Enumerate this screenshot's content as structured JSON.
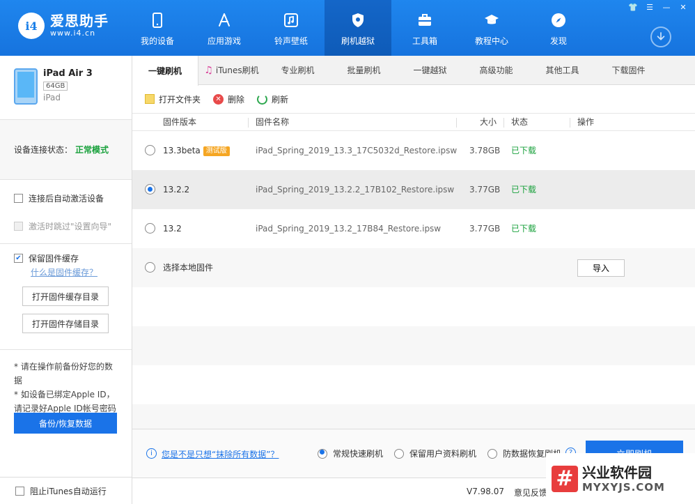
{
  "app": {
    "logo_badge": "i4",
    "logo_name": "爱思助手",
    "logo_url": "www.i4.cn"
  },
  "nav": [
    {
      "label": "我的设备",
      "icon": "phone-icon"
    },
    {
      "label": "应用游戏",
      "icon": "appstore-icon"
    },
    {
      "label": "铃声壁纸",
      "icon": "music-icon"
    },
    {
      "label": "刷机越狱",
      "icon": "shield-icon",
      "active": true
    },
    {
      "label": "工具箱",
      "icon": "toolbox-icon"
    },
    {
      "label": "教程中心",
      "icon": "graduation-cap-icon"
    },
    {
      "label": "发现",
      "icon": "compass-icon"
    }
  ],
  "device": {
    "name": "iPad Air 3",
    "capacity": "64GB",
    "type": "iPad"
  },
  "connection": {
    "label": "设备连接状态：",
    "status": "正常模式"
  },
  "options": {
    "auto_activate": "连接后自动激活设备",
    "skip_setup": "激活时跳过\"设置向导\"",
    "keep_cache": "保留固件缓存",
    "what_is_cache": "什么是固件缓存？",
    "open_cache_dir": "打开固件缓存目录",
    "open_storage_dir": "打开固件存储目录"
  },
  "notes": {
    "line1": "* 请在操作前备份好您的数据",
    "line2": "* 如设备已绑定Apple ID，请记录好Apple ID帐号密码"
  },
  "backup_button": "备份/恢复数据",
  "block_itunes": "阻止iTunes自动运行",
  "tabs": [
    {
      "label": "一键刷机",
      "active": true
    },
    {
      "label": "iTunes刷机"
    },
    {
      "label": "专业刷机"
    },
    {
      "label": "批量刷机"
    },
    {
      "label": "一键越狱"
    },
    {
      "label": "高级功能"
    },
    {
      "label": "其他工具"
    },
    {
      "label": "下载固件"
    }
  ],
  "toolbar": {
    "open_folder": "打开文件夹",
    "delete": "删除",
    "refresh": "刷新"
  },
  "table": {
    "headers": {
      "version": "固件版本",
      "name": "固件名称",
      "size": "大小",
      "status": "状态",
      "action": "操作"
    },
    "rows": [
      {
        "version": "13.3beta",
        "tag": "测试版",
        "name": "iPad_Spring_2019_13.3_17C5032d_Restore.ipsw",
        "size": "3.78GB",
        "status": "已下载",
        "selected": false
      },
      {
        "version": "13.2.2",
        "tag": "",
        "name": "iPad_Spring_2019_13.2.2_17B102_Restore.ipsw",
        "size": "3.77GB",
        "status": "已下载",
        "selected": true
      },
      {
        "version": "13.2",
        "tag": "",
        "name": "iPad_Spring_2019_13.2_17B84_Restore.ipsw",
        "size": "3.77GB",
        "status": "已下载",
        "selected": false
      }
    ],
    "local_firmware": "选择本地固件",
    "import": "导入"
  },
  "bottom": {
    "erase_link": "您是不是只想“抹除所有数据”？",
    "modes": [
      "常规快速刷机",
      "保留用户资料刷机",
      "防数据恢复刷机"
    ],
    "flash_button": "立即刷机"
  },
  "status": {
    "version": "V7.98.07",
    "feedback": "意见反馈"
  },
  "watermark": {
    "cn": "兴业软件园",
    "en": "MYXYJS.COM"
  },
  "colors": {
    "header_blue": "#1a7fe8",
    "accent": "#1a73e8",
    "success_green": "#19a13c",
    "beta_orange": "#f5a623"
  }
}
